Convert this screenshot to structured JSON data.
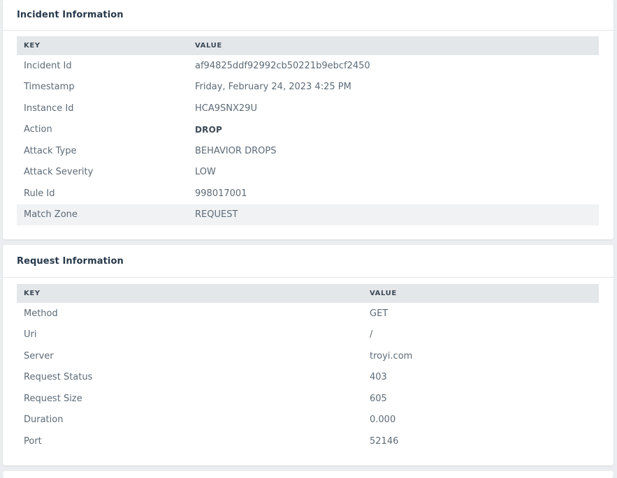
{
  "incident": {
    "title": "Incident Information",
    "columns": {
      "key": "KEY",
      "value": "VALUE"
    },
    "rows": [
      {
        "key": "Incident Id",
        "value": "af94825ddf92992cb50221b9ebcf2450"
      },
      {
        "key": "Timestamp",
        "value": "Friday, February 24, 2023 4:25 PM"
      },
      {
        "key": "Instance Id",
        "value": "HCA9SNX29U"
      },
      {
        "key": "Action",
        "value": "DROP"
      },
      {
        "key": "Attack Type",
        "value": "BEHAVIOR DROPS"
      },
      {
        "key": "Attack Severity",
        "value": "LOW"
      },
      {
        "key": "Rule Id",
        "value": "998017001"
      },
      {
        "key": "Match Zone",
        "value": "REQUEST"
      }
    ]
  },
  "request": {
    "title": "Request Information",
    "columns": {
      "key": "KEY",
      "value": "VALUE"
    },
    "rows": [
      {
        "key": "Method",
        "value": "GET"
      },
      {
        "key": "Uri",
        "value": "/"
      },
      {
        "key": "Server",
        "value": "troyi.com"
      },
      {
        "key": "Request Status",
        "value": "403"
      },
      {
        "key": "Request Size",
        "value": "605"
      },
      {
        "key": "Duration",
        "value": "0.000"
      },
      {
        "key": "Port",
        "value": "52146"
      }
    ]
  },
  "colors": {
    "page_background": "#ebedf0",
    "card_background": "#ffffff",
    "table_header_background": "#e4e7ea",
    "highlight_row_background": "#f1f2f4",
    "title_text": "#27394b",
    "body_text": "#5d6b77"
  }
}
